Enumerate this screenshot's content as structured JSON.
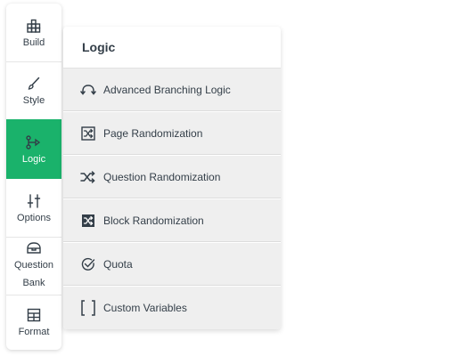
{
  "rail": {
    "items": [
      {
        "label": "Build",
        "icon": "build-grid-icon"
      },
      {
        "label": "Style",
        "icon": "brush-icon"
      },
      {
        "label": "Logic",
        "icon": "branch-icon",
        "active": true
      },
      {
        "label": "Options",
        "icon": "sliders-icon"
      },
      {
        "label_line1": "Question",
        "label_line2": "Bank",
        "icon": "question-bank-icon"
      },
      {
        "label": "Format",
        "icon": "table-icon"
      }
    ],
    "active_color": "#1ab26b"
  },
  "panel": {
    "title": "Logic",
    "items": [
      {
        "label": "Advanced Branching Logic",
        "icon": "branching-arrows-icon"
      },
      {
        "label": "Page Randomization",
        "icon": "page-shuffle-icon"
      },
      {
        "label": "Question Randomization",
        "icon": "shuffle-icon"
      },
      {
        "label": "Block Randomization",
        "icon": "block-shuffle-icon"
      },
      {
        "label": "Quota",
        "icon": "check-circle-icon"
      },
      {
        "label": "Custom Variables",
        "icon": "brackets-icon"
      }
    ]
  }
}
